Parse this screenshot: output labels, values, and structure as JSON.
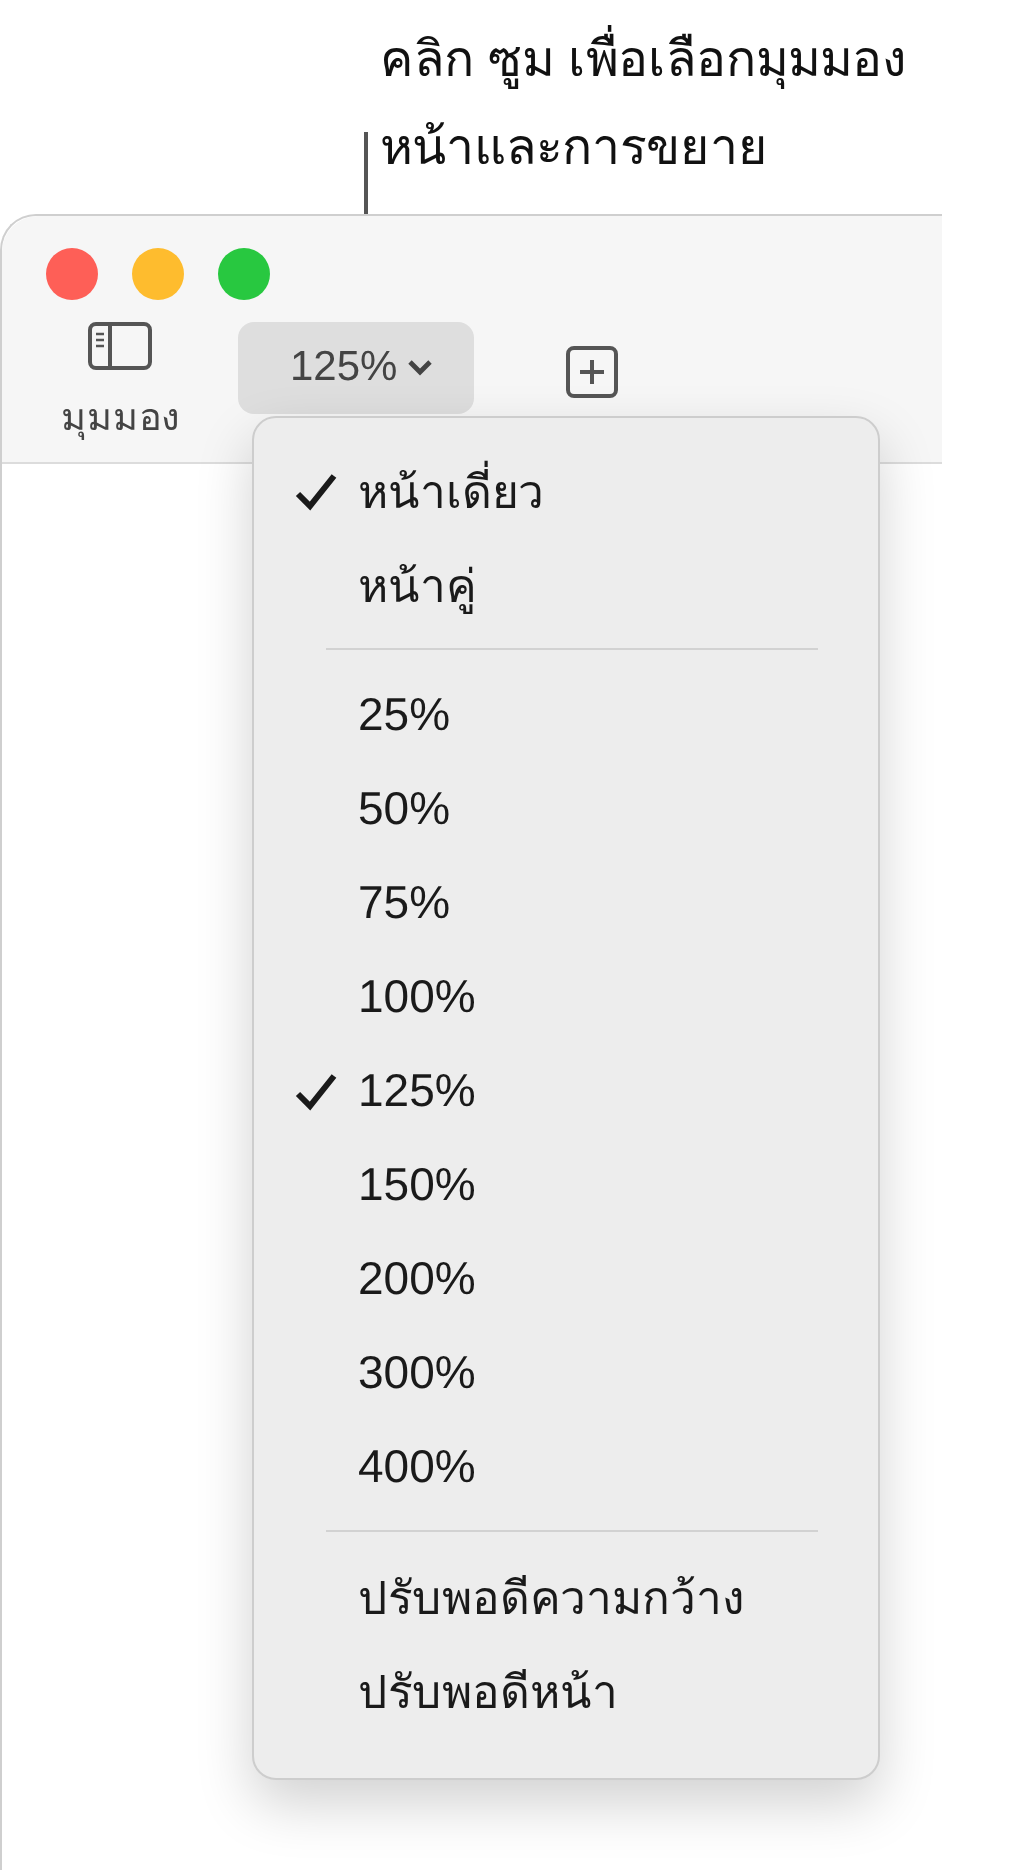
{
  "callout": {
    "lines": [
      "คลิก ซูม เพื่อเลือกมุมมอง",
      "หน้าและการขยาย"
    ]
  },
  "toolbar": {
    "view_button": {
      "label": "มุมมอง"
    },
    "zoom_button": {
      "label": "125%"
    }
  },
  "zoom_menu": {
    "sections": [
      [
        {
          "label": "หน้าเดี่ยว",
          "checked": true
        },
        {
          "label": "หน้าคู่",
          "checked": false
        }
      ],
      [
        {
          "label": "25%",
          "checked": false
        },
        {
          "label": "50%",
          "checked": false
        },
        {
          "label": "75%",
          "checked": false
        },
        {
          "label": "100%",
          "checked": false
        },
        {
          "label": "125%",
          "checked": true
        },
        {
          "label": "150%",
          "checked": false
        },
        {
          "label": "200%",
          "checked": false
        },
        {
          "label": "300%",
          "checked": false
        },
        {
          "label": "400%",
          "checked": false
        }
      ],
      [
        {
          "label": "ปรับพอดีความกว้าง",
          "checked": false
        },
        {
          "label": "ปรับพอดีหน้า",
          "checked": false
        }
      ]
    ]
  }
}
